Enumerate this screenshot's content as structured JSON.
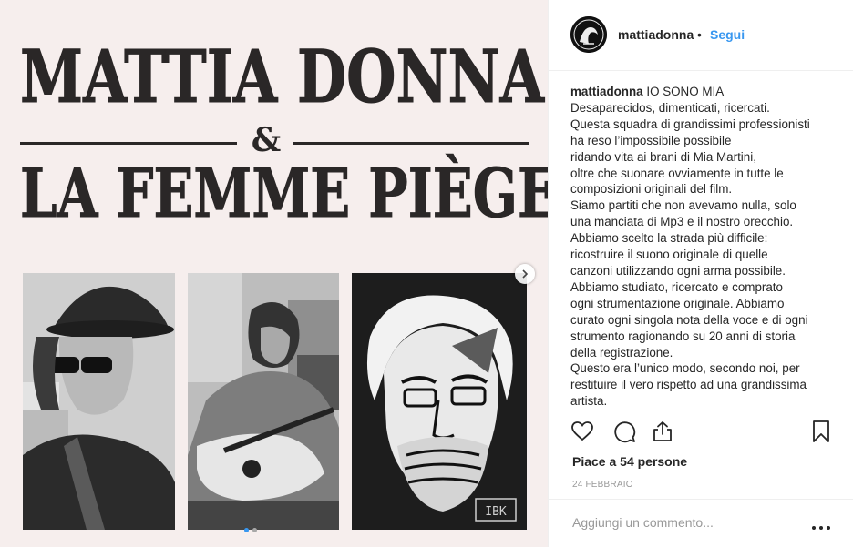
{
  "post_image": {
    "headline_line1": "MATTIA DONNA",
    "ampersand": "&",
    "headline_line2": "LA FEMME PIÈGE",
    "signature": "IBK"
  },
  "header": {
    "username": "mattiadonna",
    "separator": "•",
    "follow_label": "Segui"
  },
  "caption": {
    "username": "mattiadonna",
    "first_line": "IO SONO MIA",
    "lines": [
      "Desaparecidos, dimenticati, ricercati.",
      "Questa squadra di grandissimi professionisti",
      "ha reso l’impossibile possibile",
      "ridando vita ai brani di Mia Martini,",
      "oltre che suonare ovviamente in tutte le",
      "composizioni originali del film.",
      "Siamo partiti che non avevamo nulla, solo",
      "una manciata di Mp3 e il nostro orecchio.",
      "Abbiamo scelto la strada più difficile:",
      "ricostruire il suono originale di quelle",
      "canzoni utilizzando ogni arma possibile.",
      "Abbiamo studiato, ricercato e comprato",
      "ogni strumentazione originale. Abbiamo",
      "curato ogni singola nota della voce e di ogni",
      "strumento ragionando su 20 anni di storia",
      "della registrazione.",
      "Questo era l’unico modo, secondo noi, per",
      "restituire il vero rispetto ad una grandissima",
      "artista."
    ]
  },
  "likes": {
    "text": "Piace a 54 persone"
  },
  "date": {
    "text": "24 FEBBRAIO"
  },
  "comment": {
    "placeholder": "Aggiungi un commento..."
  },
  "carousel": {
    "slide_count": 2,
    "active_index": 0
  },
  "icons": {
    "like": "heart-icon",
    "comment": "comment-icon",
    "share": "share-icon",
    "save": "bookmark-icon",
    "more": "more-icon",
    "next": "chevron-right-icon"
  },
  "colors": {
    "link_blue": "#3897f0",
    "poster_bg": "#f6eeed",
    "poster_ink": "#2a2727",
    "muted_text": "#999999",
    "divider": "#efefef"
  }
}
